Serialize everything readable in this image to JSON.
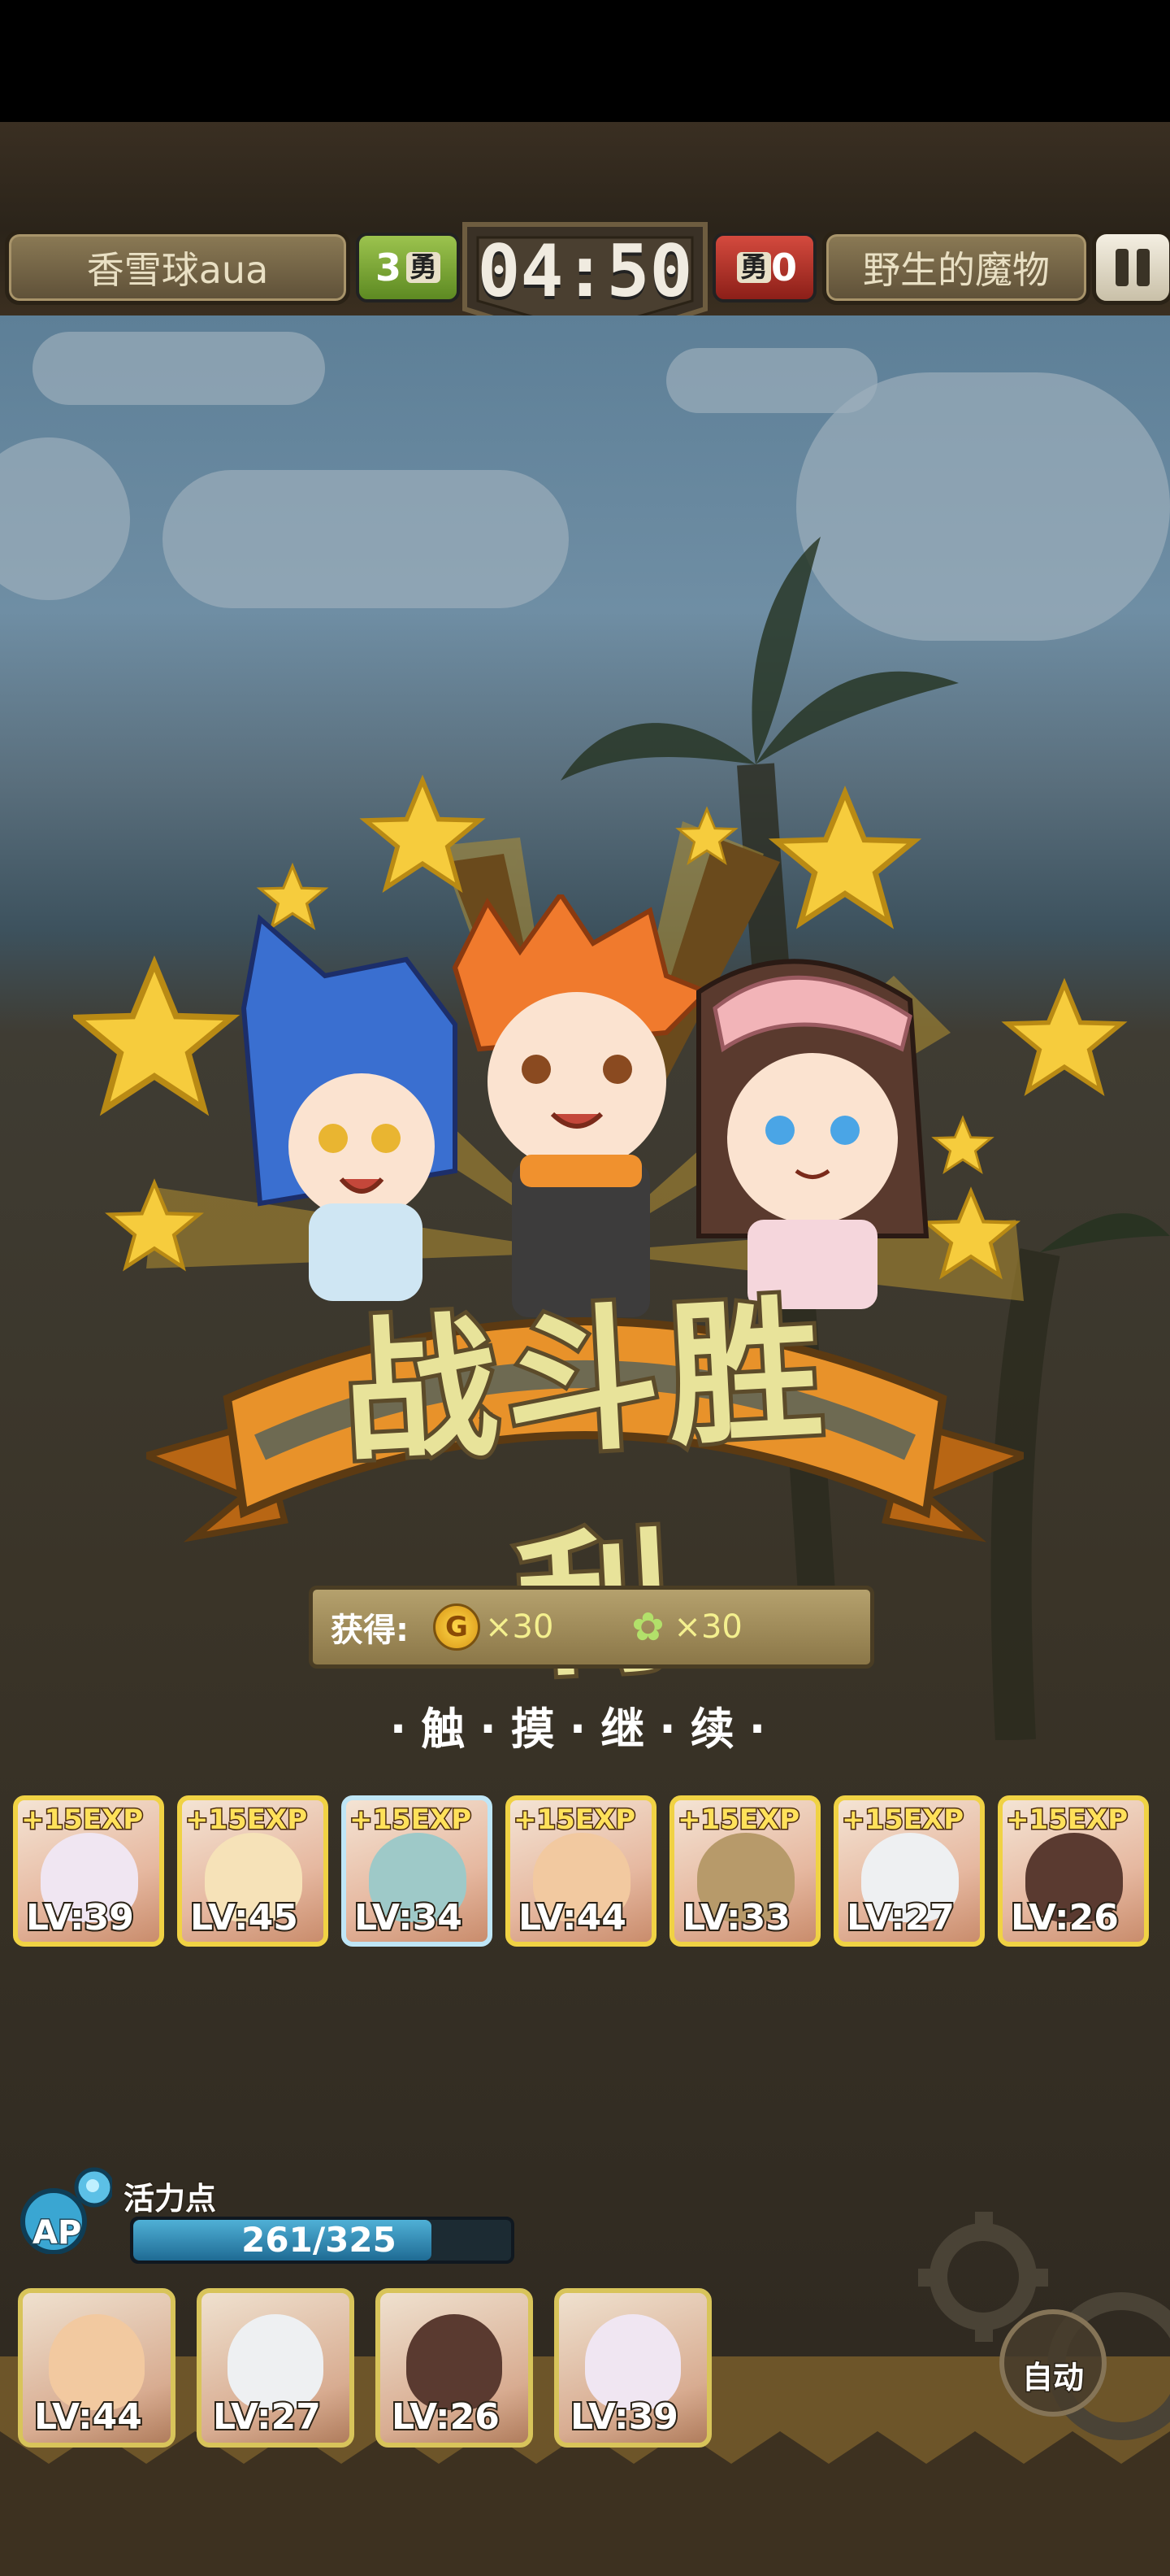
{
  "header": {
    "player_name": "香雪球aua",
    "player_score": "3",
    "enemy_score": "0",
    "enemy_name": "野生的魔物",
    "timer": "04:50",
    "rank_glyph": "勇"
  },
  "victory": {
    "title": "战斗胜利",
    "rewards_label": "获得:",
    "gold_icon_text": "G",
    "gold_amount": "×30",
    "leaf_amount": "×30",
    "continue_text": "·触·摸·继·续·"
  },
  "hero_cards": [
    {
      "exp": "+15EXP",
      "level": "LV:39"
    },
    {
      "exp": "+15EXP",
      "level": "LV:45"
    },
    {
      "exp": "+15EXP",
      "level": "LV:34"
    },
    {
      "exp": "+15EXP",
      "level": "LV:44"
    },
    {
      "exp": "+15EXP",
      "level": "LV:33"
    },
    {
      "exp": "+15EXP",
      "level": "LV:27"
    },
    {
      "exp": "+15EXP",
      "level": "LV:26"
    }
  ],
  "ap": {
    "title": "活力点",
    "label": "AP",
    "current": 261,
    "max": 325,
    "text": "261/325"
  },
  "team_slots": [
    {
      "level": "LV:44"
    },
    {
      "level": "LV:27"
    },
    {
      "level": "LV:26"
    },
    {
      "level": "LV:39"
    }
  ],
  "auto_button": "自动",
  "colors": {
    "star": "#f6cc3d",
    "banner_orange": "#e8922a",
    "card_border": "#f0d244",
    "ap_fill": "#2f8ab8"
  }
}
